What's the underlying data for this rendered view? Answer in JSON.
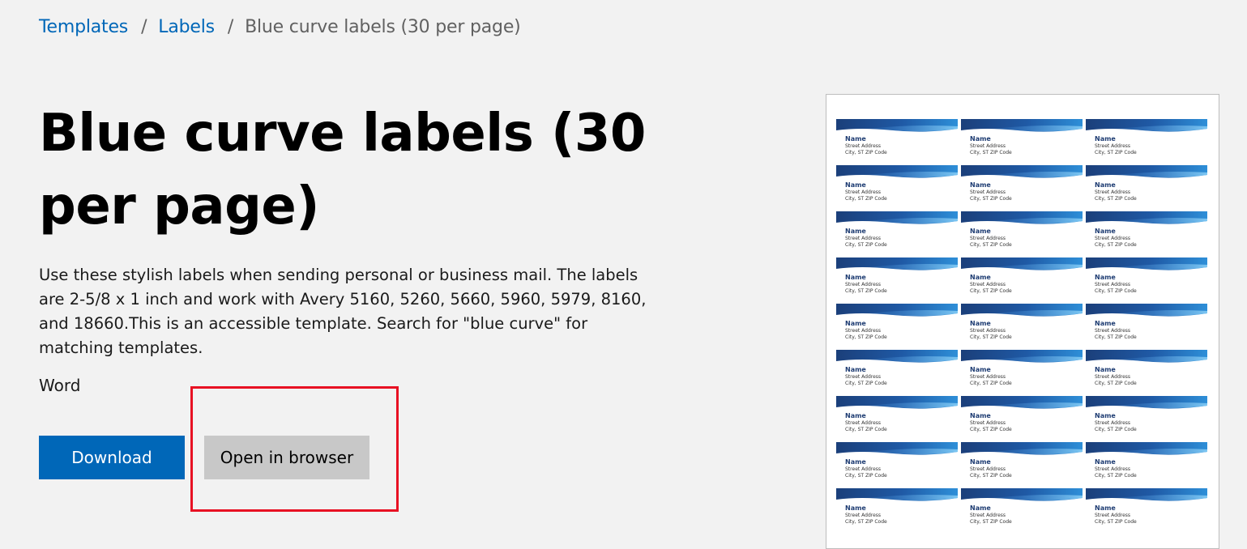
{
  "breadcrumb": {
    "items": [
      {
        "label": "Templates"
      },
      {
        "label": "Labels"
      }
    ],
    "separator": "/",
    "current": "Blue curve labels (30 per page)"
  },
  "page": {
    "title": "Blue curve labels (30 per page)",
    "description": "Use these stylish labels when sending personal or business mail. The labels are 2-5/8 x 1 inch and work with Avery 5160, 5260, 5660, 5960, 5979, 8160, and 18660.This is an accessible template. Search for \"blue curve\" for matching templates.",
    "app": "Word"
  },
  "actions": {
    "download_label": "Download",
    "open_browser_label": "Open in browser"
  },
  "preview": {
    "label_name": "Name",
    "label_street": "Street Address",
    "label_city": "City, ST ZIP Code"
  },
  "colors": {
    "link": "#0067b8",
    "primary_button": "#0067b8",
    "secondary_button": "#c8c8c8",
    "highlight": "#e81123",
    "background": "#f2f2f2",
    "label_blue_dark": "#1b3f7a",
    "label_blue_light": "#2e8fd8"
  }
}
